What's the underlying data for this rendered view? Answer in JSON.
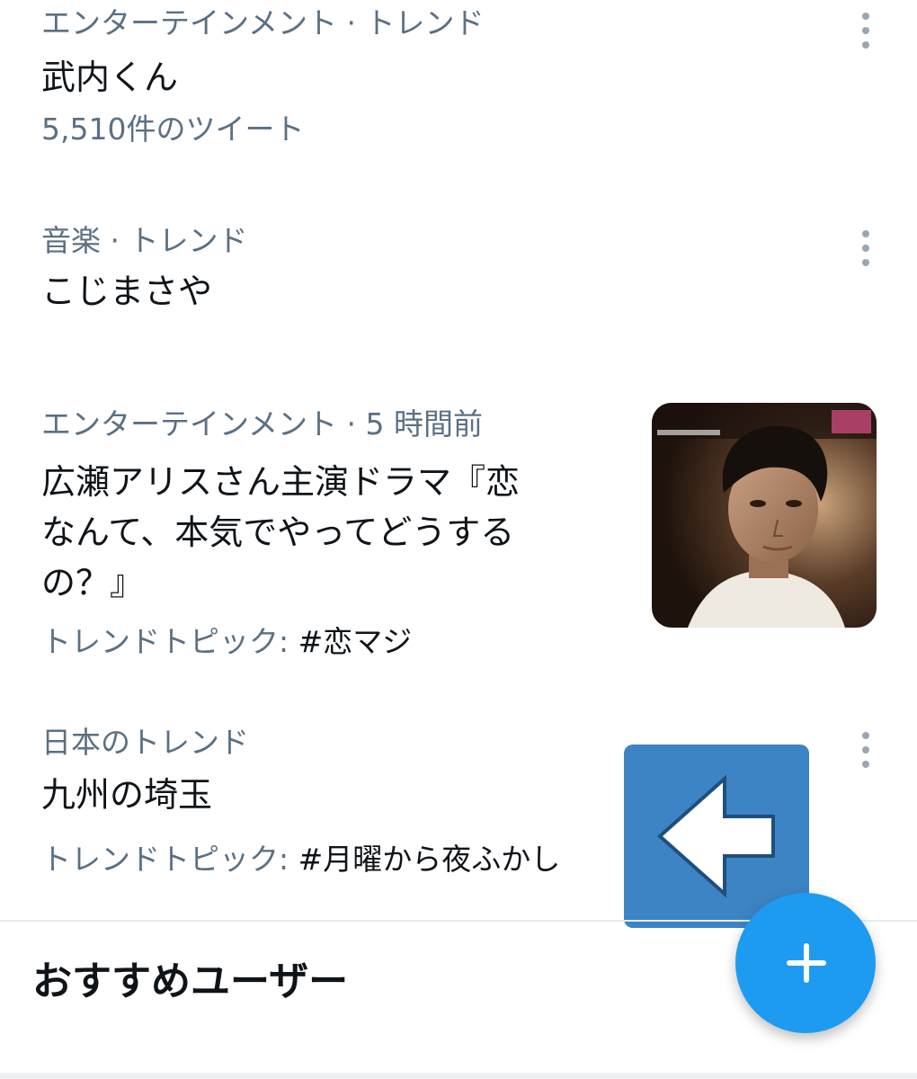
{
  "trends": [
    {
      "meta": "エンターテインメント · トレンド",
      "title": "武内くん",
      "sub": "5,510件のツイート"
    },
    {
      "meta": "音楽 · トレンド",
      "title": "こじまさや"
    },
    {
      "meta": "エンターテインメント · 5 時間前",
      "title_line1": "広瀬アリスさん主演ドラマ『恋",
      "title_line2": "なんて、本気でやってどうする",
      "title_line3": "の？』",
      "sub_label": "トレンドトピック: ",
      "sub_tag": "#恋マジ",
      "thumbnail": "drama-still-photo"
    },
    {
      "meta": "日本のトレンド",
      "title": "九州の埼玉",
      "sub_label": "トレンドトピック: ",
      "sub_tag": "#月曜から夜ふかし"
    }
  ],
  "recommended": {
    "title": "おすすめユーザー"
  },
  "icons": {
    "more": "more-vertical-icon",
    "back": "back-arrow-icon",
    "compose": "plus-icon"
  },
  "colors": {
    "primary_text": "#0f1419",
    "secondary_text": "#5b7083",
    "fab": "#1d9bf0",
    "overlay": "#3c84c4"
  }
}
